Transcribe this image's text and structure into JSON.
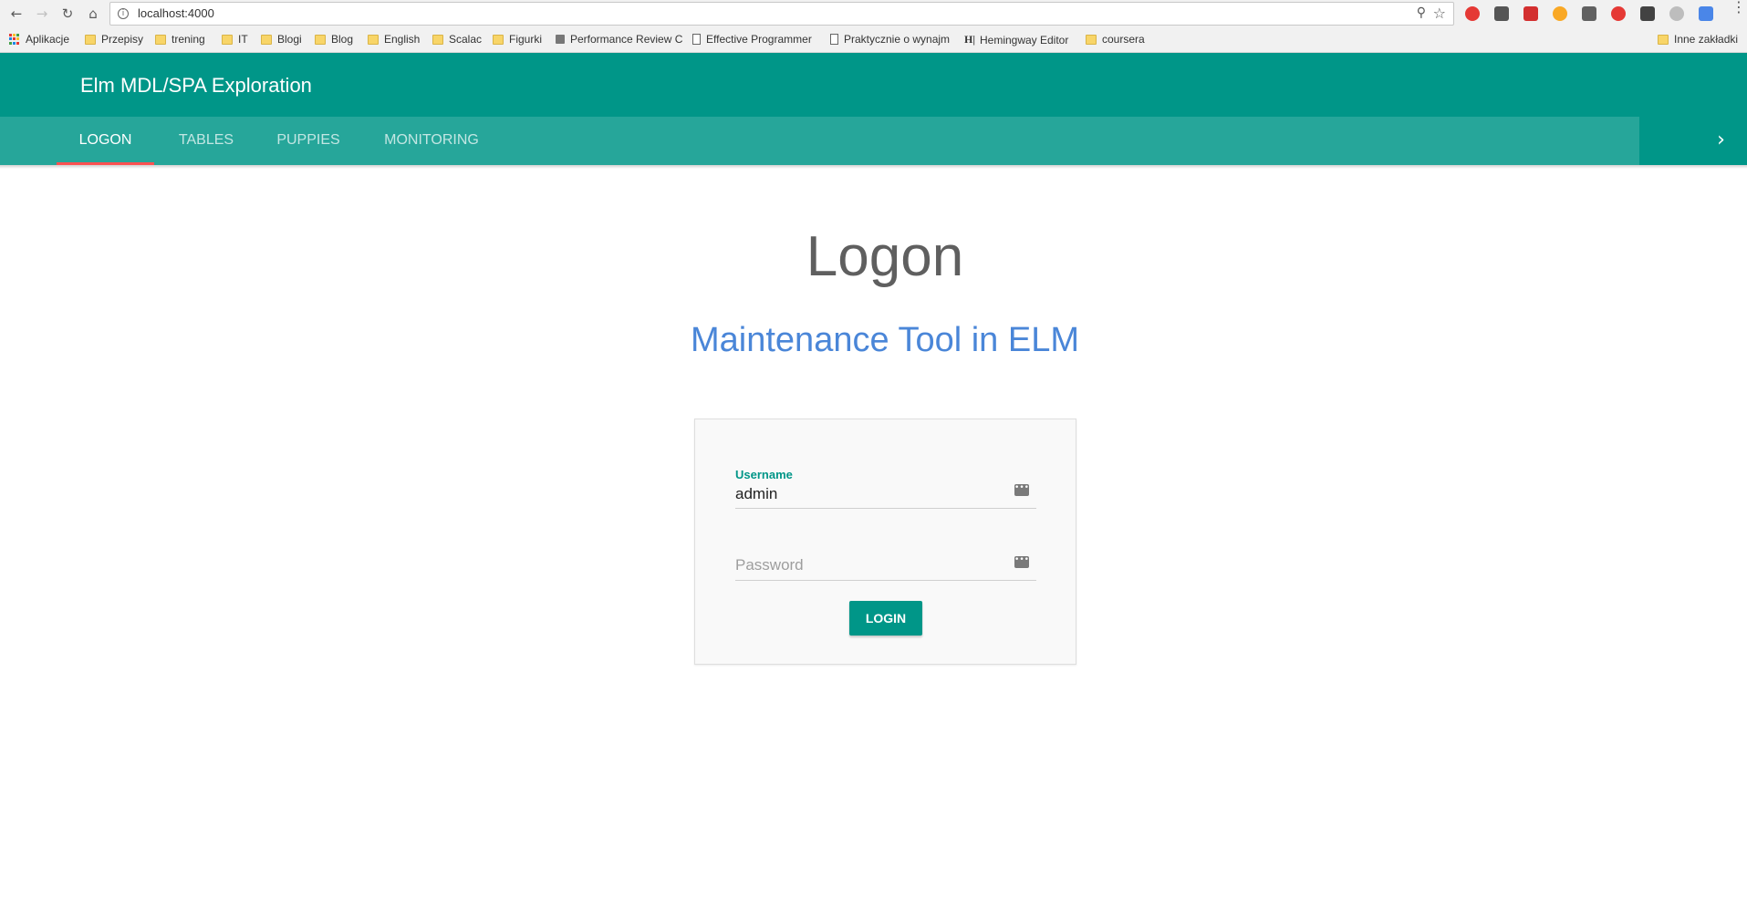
{
  "browser": {
    "url": "localhost:4000",
    "bookmarks": [
      {
        "label": "Aplikacje",
        "icon": "apps-grid-icon"
      },
      {
        "label": "Przepisy",
        "icon": "folder-icon"
      },
      {
        "label": "trening",
        "icon": "folder-icon"
      },
      {
        "label": "IT",
        "icon": "folder-icon"
      },
      {
        "label": "Blogi",
        "icon": "folder-icon"
      },
      {
        "label": "Blog",
        "icon": "folder-icon"
      },
      {
        "label": "English",
        "icon": "folder-icon"
      },
      {
        "label": "Scalac",
        "icon": "folder-icon"
      },
      {
        "label": "Figurki",
        "icon": "folder-icon"
      },
      {
        "label": "Performance Review C",
        "icon": "page-icon"
      },
      {
        "label": "Effective Programmer",
        "icon": "page-icon"
      },
      {
        "label": "Praktycznie o wynajm",
        "icon": "page-icon"
      },
      {
        "label": "Hemingway Editor",
        "icon": "hemingway-icon"
      },
      {
        "label": "coursera",
        "icon": "folder-icon"
      }
    ],
    "other_bookmarks": "Inne zakładki"
  },
  "app": {
    "title": "Elm MDL/SPA Exploration",
    "tabs": [
      {
        "label": "LOGON",
        "active": true
      },
      {
        "label": "TABLES",
        "active": false
      },
      {
        "label": "PUPPIES",
        "active": false
      },
      {
        "label": "MONITORING",
        "active": false
      }
    ],
    "accent_color": "#009688",
    "tab_indicator_color": "#ff5252"
  },
  "page": {
    "title": "Logon",
    "subtitle": "Maintenance Tool in ELM"
  },
  "form": {
    "username_label": "Username",
    "username_value": "admin",
    "password_placeholder": "Password",
    "login_label": "LOGIN"
  }
}
